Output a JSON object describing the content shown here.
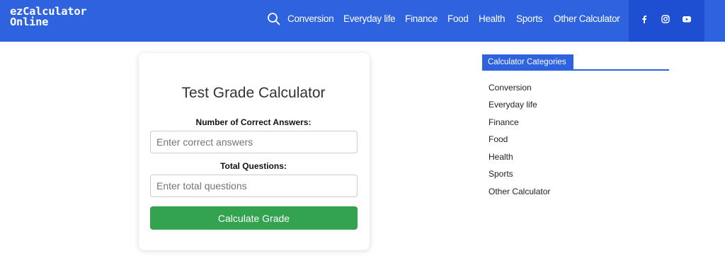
{
  "header": {
    "logo_line1": "ezCalculator",
    "logo_line2": "Online",
    "nav": [
      {
        "label": "Conversion"
      },
      {
        "label": "Everyday life"
      },
      {
        "label": "Finance"
      },
      {
        "label": "Food"
      },
      {
        "label": "Health"
      },
      {
        "label": "Sports"
      },
      {
        "label": "Other Calculator"
      }
    ],
    "social_icons": [
      "facebook-icon",
      "instagram-icon",
      "youtube-icon"
    ],
    "bg_color": "#2e62de"
  },
  "calculator": {
    "title": "Test Grade Calculator",
    "correct_label": "Number of Correct Answers:",
    "correct_placeholder": "Enter correct answers",
    "correct_value": "",
    "total_label": "Total Questions:",
    "total_placeholder": "Enter total questions",
    "total_value": "",
    "button_label": "Calculate Grade",
    "button_color": "#34a350"
  },
  "sidebar": {
    "heading": "Calculator Categories",
    "items": [
      {
        "label": "Conversion"
      },
      {
        "label": "Everyday life"
      },
      {
        "label": "Finance"
      },
      {
        "label": "Food"
      },
      {
        "label": "Health"
      },
      {
        "label": "Sports"
      },
      {
        "label": "Other Calculator"
      }
    ]
  }
}
